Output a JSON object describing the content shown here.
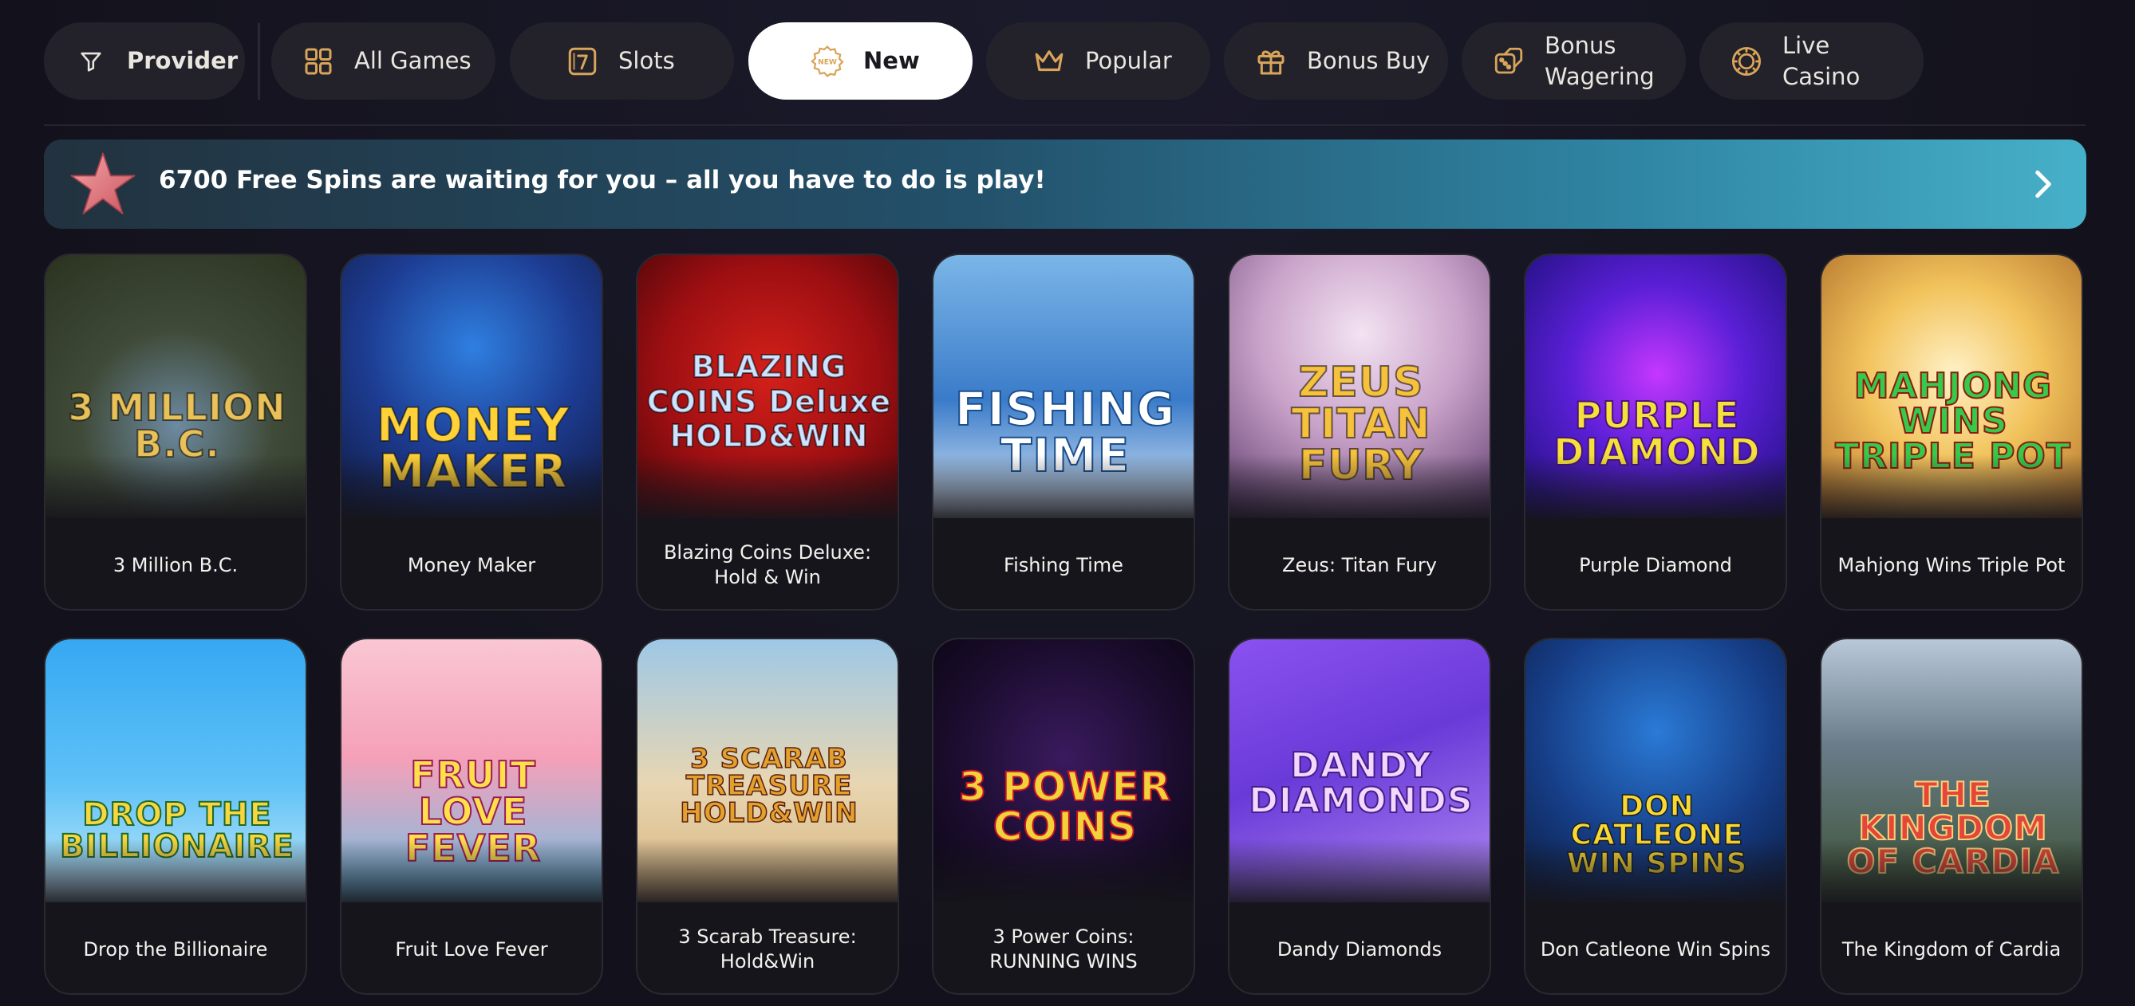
{
  "filters": [
    {
      "id": "provider",
      "label": "Provider",
      "icon": "funnel-icon",
      "active": false
    },
    {
      "id": "all-games",
      "label": "All Games",
      "icon": "grid-icon",
      "active": false
    },
    {
      "id": "slots",
      "label": "Slots",
      "icon": "slot-seven-icon",
      "active": false
    },
    {
      "id": "new",
      "label": "New",
      "icon": "new-badge-icon",
      "active": true
    },
    {
      "id": "popular",
      "label": "Popular",
      "icon": "crown-icon",
      "active": false
    },
    {
      "id": "bonus-buy",
      "label": "Bonus Buy",
      "icon": "gift-icon",
      "active": false
    },
    {
      "id": "bonus-wagering",
      "label": "Bonus Wagering",
      "icon": "dice-icon",
      "active": false
    },
    {
      "id": "live-casino",
      "label": "Live Casino",
      "icon": "chip-icon",
      "active": false
    }
  ],
  "banner": {
    "text": "6700 Free Spins are waiting for you – all you have to do is play!",
    "icon": "starfish-icon",
    "action_icon": "chevron-right-icon"
  },
  "games": [
    {
      "name": "3 Million B.C.",
      "logo": "3 MILLION B.C."
    },
    {
      "name": "Money Maker",
      "logo": "MONEY MAKER"
    },
    {
      "name": "Blazing Coins Deluxe: Hold & Win",
      "logo": "BLAZING COINS Deluxe HOLD&WIN"
    },
    {
      "name": "Fishing Time",
      "logo": "FISHING TIME"
    },
    {
      "name": "Zeus: Titan Fury",
      "logo": "ZEUS TITAN FURY"
    },
    {
      "name": "Purple Diamond",
      "logo": "PURPLE DIAMOND"
    },
    {
      "name": "Mahjong Wins Triple Pot",
      "logo": "MAHJONG WINS TRIPLE POT"
    },
    {
      "name": "Drop the Billionaire",
      "logo": "DROP THE BILLIONAIRE"
    },
    {
      "name": "Fruit Love Fever",
      "logo": "FRUIT LOVE FEVER"
    },
    {
      "name": "3 Scarab Treasure: Hold&Win",
      "logo": "3 SCARAB TREASURE HOLD&WIN"
    },
    {
      "name": "3 Power Coins: RUNNING WINS",
      "logo": "3 POWER COINS"
    },
    {
      "name": "Dandy Diamonds",
      "logo": "DANDY DIAMONDS"
    },
    {
      "name": "Don Catleone Win Spins",
      "logo": "DON CATLEONE WIN SPINS"
    },
    {
      "name": "The Kingdom of Cardia",
      "logo": "THE KINGDOM OF CARDIA"
    }
  ],
  "colors": {
    "background": "#14131f",
    "pill": "#23222a",
    "pill_active": "#ffffff",
    "icon_gold": "#d9a55a",
    "banner_start": "#22323f",
    "banner_end": "#47b0c9"
  }
}
